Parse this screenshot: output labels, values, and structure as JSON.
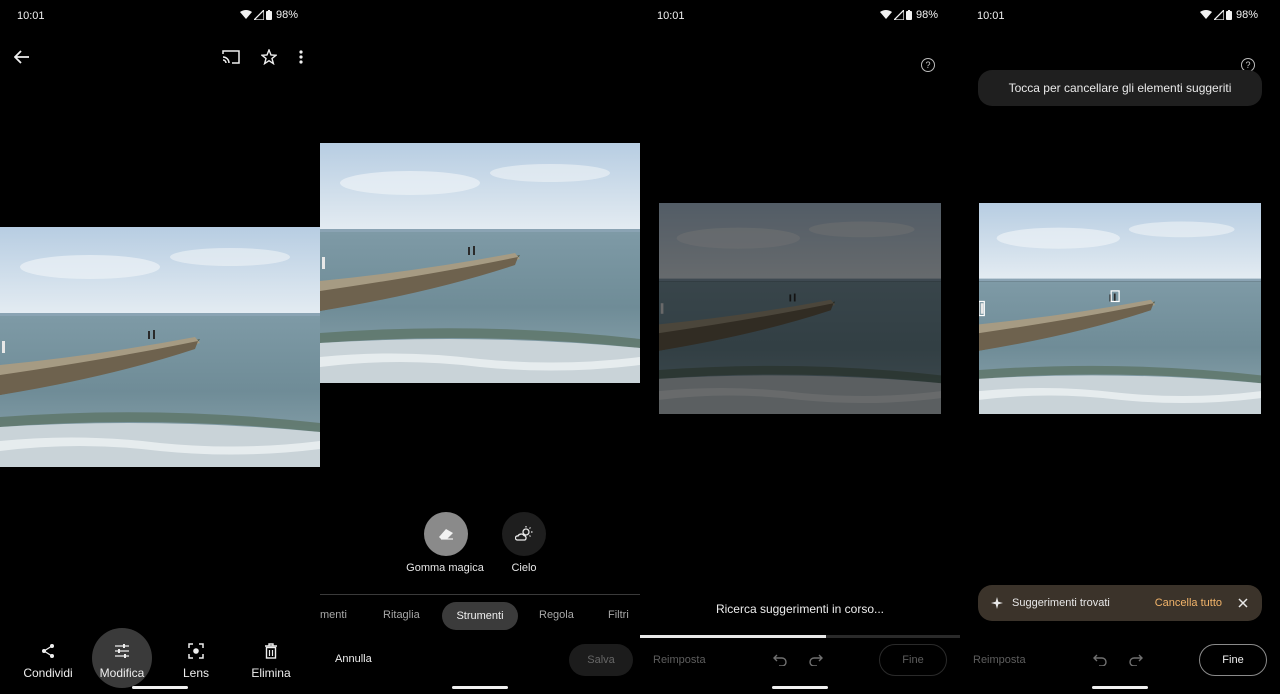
{
  "status": {
    "time": "10:01",
    "battery": "98%"
  },
  "panel1": {
    "actions": {
      "share": "Condividi",
      "edit": "Modifica",
      "lens": "Lens",
      "delete": "Elimina"
    }
  },
  "panel2": {
    "tools": {
      "magic_eraser": "Gomma magica",
      "sky": "Cielo"
    },
    "tabs": [
      "menti",
      "Ritaglia",
      "Strumenti",
      "Regola",
      "Filtri"
    ],
    "active_tab": "Strumenti",
    "cancel": "Annulla",
    "save": "Salva"
  },
  "panel3": {
    "searching": "Ricerca suggerimenti in corso...",
    "progress": 0.58,
    "reset": "Reimposta",
    "done": "Fine"
  },
  "panel4": {
    "tooltip": "Tocca per cancellare gli elementi suggeriti",
    "found": "Suggerimenti trovati",
    "clear_all": "Cancella tutto",
    "reset": "Reimposta",
    "done": "Fine"
  },
  "colors": {
    "accent_orange": "#f2b46a",
    "snackbar_bg": "#3b332a"
  }
}
